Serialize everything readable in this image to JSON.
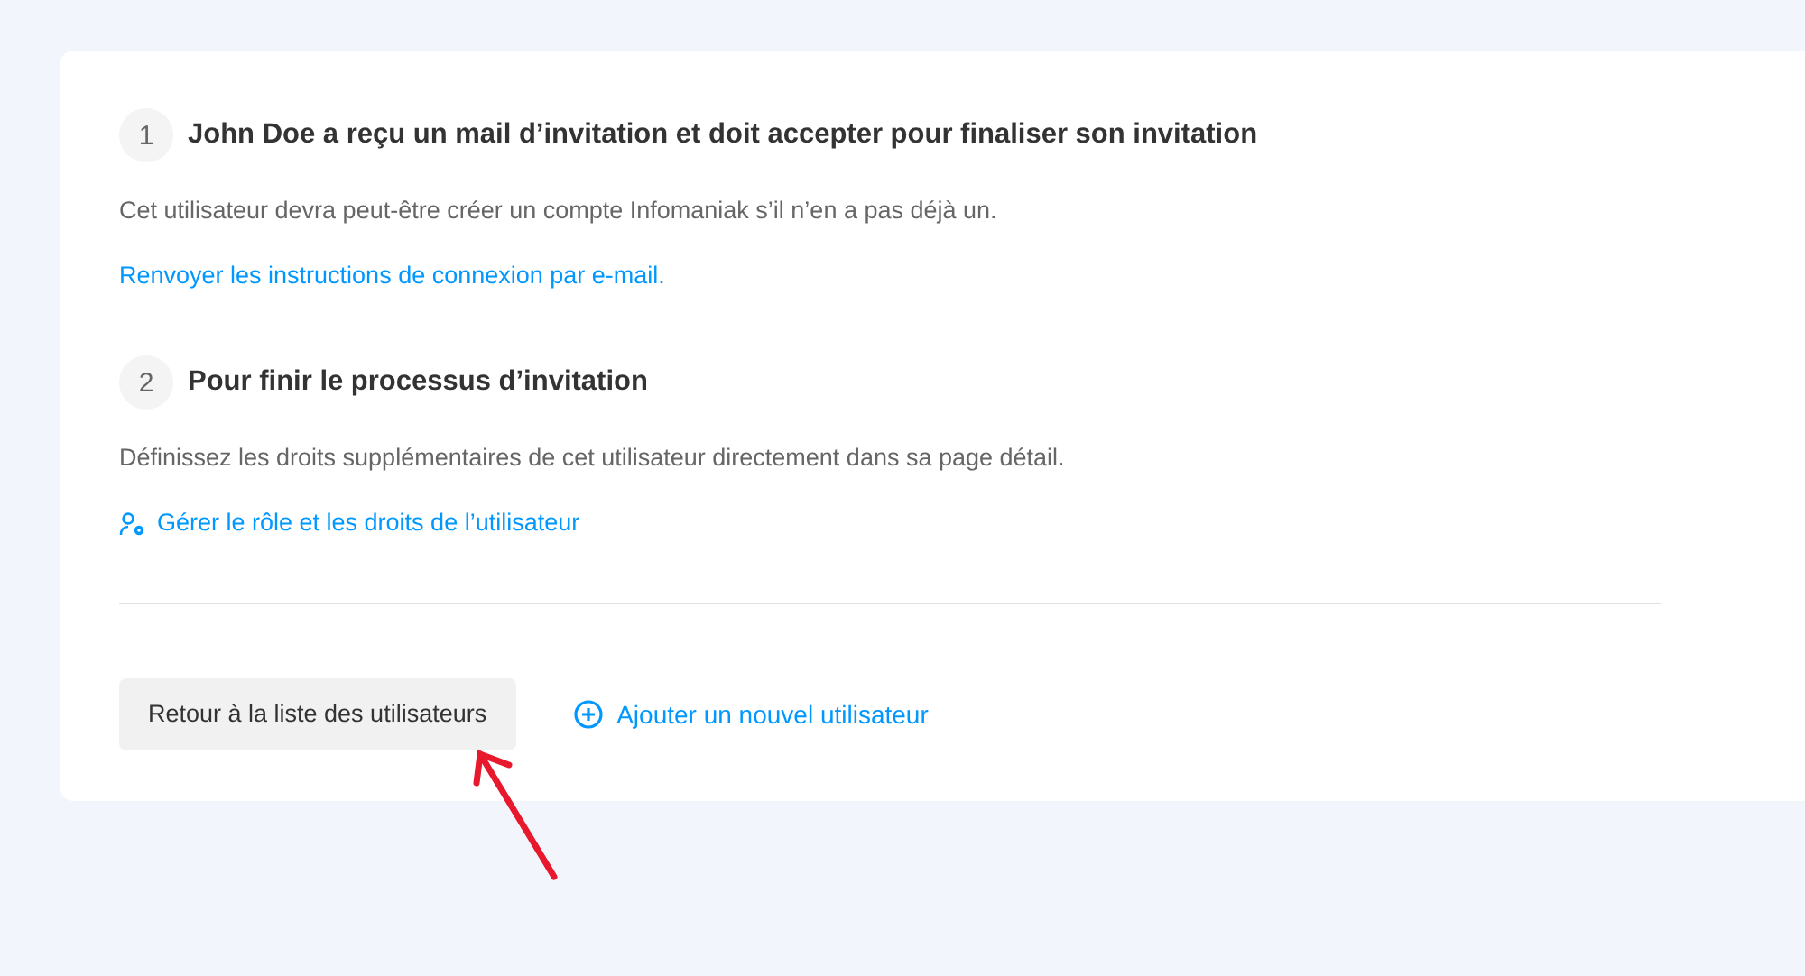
{
  "steps": [
    {
      "number": "1",
      "title": "John Doe a reçu un mail d’invitation et doit accepter pour finaliser son invitation",
      "text": "Cet utilisateur devra peut-être créer un compte Infomaniak s’il n’en a pas déjà un.",
      "link": {
        "label": "Renvoyer les instructions de connexion par e-mail.",
        "kind": "plain"
      }
    },
    {
      "number": "2",
      "title": "Pour finir le processus d’invitation",
      "text": "Définissez les droits supplémentaires de cet utilisateur directement dans sa page détail.",
      "link": {
        "label": "Gérer le rôle et les droits de l’utilisateur",
        "kind": "user-settings"
      }
    }
  ],
  "actions": [
    {
      "label": "Retour à la liste des utilisateurs",
      "kind": "button"
    },
    {
      "label": "Ajouter un nouvel utilisateur",
      "kind": "add-link"
    }
  ],
  "annotation": {
    "kind": "arrow"
  }
}
